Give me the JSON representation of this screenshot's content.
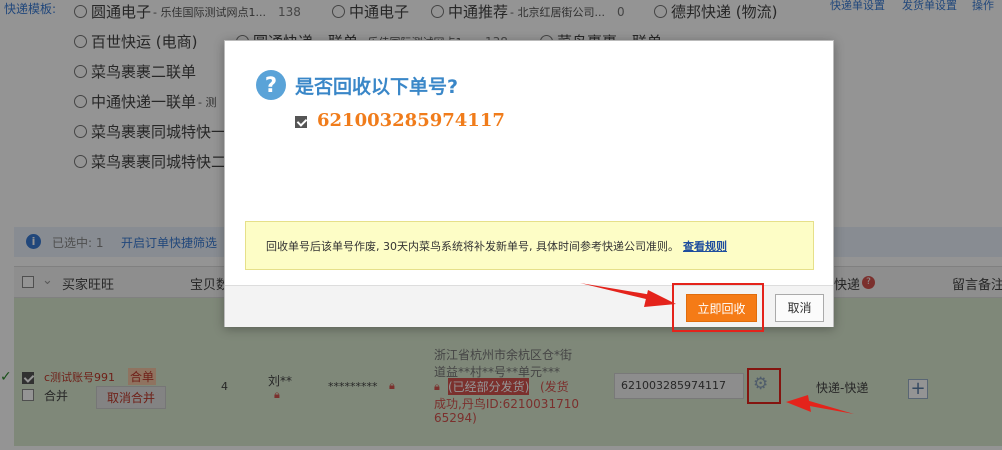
{
  "header": {
    "template_label": "快递模板:",
    "top_right_links": [
      "快递单设置",
      "发货单设置",
      "操作"
    ]
  },
  "templates": [
    {
      "label": "圆通电子",
      "sub": "- 乐佳国际测试网点1...",
      "count": "138"
    },
    {
      "label": "中通电子",
      "sub": "",
      "count": ""
    },
    {
      "label": "中通推荐",
      "sub": "- 北京红居街公司...",
      "count": "0"
    },
    {
      "label": "德邦快递 (物流)",
      "sub": "",
      "count": ""
    },
    {
      "label": "百世快运 (电商)",
      "sub": "",
      "count": ""
    },
    {
      "label": "圆通快递一联单",
      "sub": "- 乐佳国际测试网点1...",
      "count": "138"
    },
    {
      "label": "菜鸟裹裹一联单",
      "sub": "",
      "count": ""
    },
    {
      "label": "菜鸟裹裹二联单",
      "sub": "",
      "count": ""
    },
    {
      "label": "中通快递一联单",
      "sub": "- 测",
      "count": ""
    },
    {
      "label": "菜鸟裹裹同城特快一",
      "sub": "",
      "count": ""
    },
    {
      "label": "菜鸟裹裹同城特快二",
      "sub": "",
      "count": ""
    }
  ],
  "info_bar": {
    "selected_text": "已选中: 1",
    "link_text": "开启订单快捷筛选"
  },
  "table": {
    "headers": [
      "买家旺旺",
      "宝贝数",
      "快递",
      "留言备注"
    ],
    "row": {
      "buyer": "c测试账号991",
      "merge_tag": "合单",
      "merge_label": "合并",
      "cancel_merge": "取消合并",
      "qty": "4",
      "name": "刘**",
      "phone": "*********",
      "address_line1": "浙江省杭州市余杭区仓*街",
      "address_line2": "道益**村**号**单元***",
      "status_tag": "(已经部分发货)",
      "status_rest": "(发货",
      "status_line2": "成功,丹鸟ID:6210031710",
      "status_line3": "65294)",
      "tracking_number": "621003285974117",
      "express": "快递-快递"
    }
  },
  "dialog": {
    "title": "是否回收以下单号?",
    "waybill_number": "621003285974117",
    "notice_text": "回收单号后该单号作废, 30天内菜鸟系统将补发新单号, 具体时间参考快递公司准则。",
    "notice_link": "查看规则",
    "confirm_label": "立即回收",
    "cancel_label": "取消"
  },
  "colors": {
    "accent_blue": "#3a87c8",
    "confirm_orange": "#f57b16",
    "highlight_red": "#e4231b",
    "row_green": "#dbead1"
  }
}
